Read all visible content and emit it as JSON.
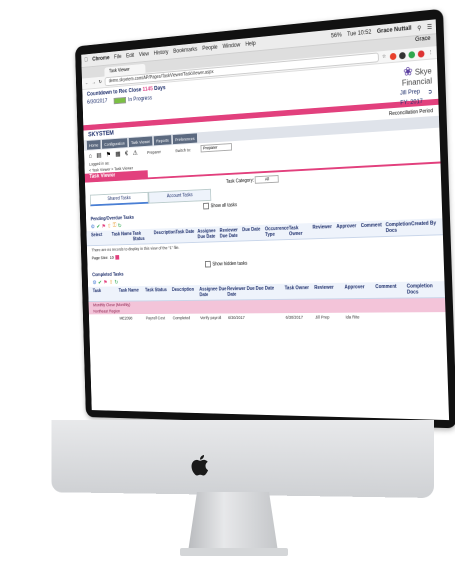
{
  "menubar": {
    "apple": "",
    "items": [
      "Chrome",
      "File",
      "Edit",
      "View",
      "History",
      "Bookmarks",
      "People",
      "Window",
      "Help"
    ],
    "battery": "56%",
    "clock": "Tue 10:52",
    "user": "Grace Nuttall"
  },
  "browser": {
    "tab_title": "Task Viewer",
    "url": "demo.skyetem.com/AP/Pages/TaskViewer/TaskViewer.aspx",
    "profile": "Grace"
  },
  "header": {
    "countdown_label": "Countdown to Rec Close",
    "countdown_days": "1145",
    "countdown_suffix": "Days",
    "progress_label": "In Progress",
    "date": "6/30/2017",
    "role": "Jill Prep",
    "fiscal_year": "FY: 2017",
    "logo_line1": "Skye",
    "logo_line2": "Financial",
    "system_name": "SKYSTEM"
  },
  "nav": {
    "buttons": [
      "Home",
      "Configuration",
      "Task Viewer",
      "Reports",
      "Preferences"
    ]
  },
  "recon": {
    "label": "Reconciliation Period"
  },
  "toolbar": {
    "preparer_label": "Preparer",
    "switch_label": "Switch to:",
    "switch_value": "Preparer"
  },
  "user": {
    "logged_in": "Logged in as:",
    "breadcrumb": "< Task Viewer > Task Viewer"
  },
  "page_title": "Task Viewer",
  "task_category": {
    "label": "Task Category:",
    "value": "All"
  },
  "tabs": {
    "tab1": "Shared Tasks",
    "tab2": "Account Tasks"
  },
  "pending": {
    "show_all_label": "Show all tasks",
    "section_label": "Pending/Overdue Tasks",
    "columns": [
      "Select",
      "Task Name",
      "Task Status",
      "Description",
      "Task Date",
      "Assignee Due Date",
      "Reviewer Due Date",
      "Due Date",
      "Occurrence Type",
      "Task Owner",
      "Reviewer",
      "Approver",
      "Comment",
      "Completion Docs",
      "Created By"
    ],
    "empty_message": "There are no records to display in this view of the “1” file."
  },
  "pager": {
    "label": "Page Size:",
    "value": "10"
  },
  "completed": {
    "show_hidden_label": "Show hidden tasks",
    "section_label": "Completed Tasks",
    "columns": [
      "Task",
      "Task Name",
      "Task Status",
      "Description",
      "Assignee Due Date",
      "Reviewer Due Date",
      "Due Date",
      "Task Owner",
      "Reviewer",
      "Approver",
      "Comment",
      "Completion Docs"
    ],
    "group1": "Monthly Close (Monthly)",
    "group2": "Northeast Region",
    "row": [
      "",
      "ME2098",
      "Payroll Cost",
      "Completed",
      "Verify payroll",
      "6/30/2017",
      "",
      "6/30/2017",
      "Jill Prep",
      "Ida Rite",
      "",
      ""
    ]
  },
  "colors": {
    "accent_pink": "#e2407d",
    "navy": "#1d2e6b",
    "blue": "#4a7fd4"
  }
}
